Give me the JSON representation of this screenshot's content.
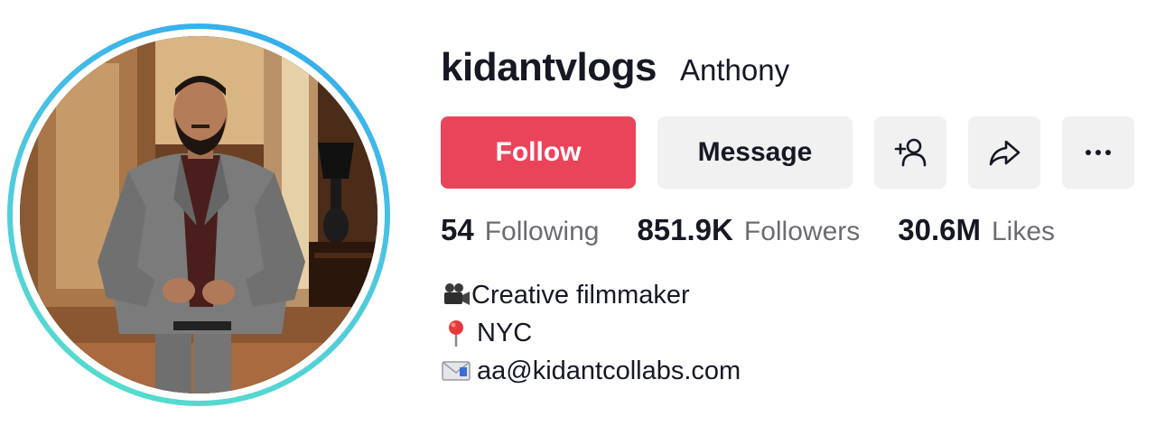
{
  "profile": {
    "username": "kidantvlogs",
    "nickname": "Anthony",
    "avatar_alt": "profile photo of man in grey plaid suit",
    "ring_colors": [
      "#2fa8f0",
      "#57e0c8"
    ]
  },
  "actions": {
    "follow_label": "Follow",
    "message_label": "Message",
    "add_friend_icon": "add-person-icon",
    "share_icon": "share-arrow-icon",
    "more_icon": "more-dots-icon",
    "follow_color": "#ea445a"
  },
  "stats": [
    {
      "value": "54",
      "label": "Following"
    },
    {
      "value": "851.9K",
      "label": "Followers"
    },
    {
      "value": "30.6M",
      "label": "Likes"
    }
  ],
  "bio": [
    {
      "icon": "video-camera-icon",
      "text": "Creative filmmaker"
    },
    {
      "icon": "pushpin-icon",
      "text": "NYC"
    },
    {
      "icon": "envelope-icon",
      "text": "aa@kidantcollabs.com"
    }
  ]
}
